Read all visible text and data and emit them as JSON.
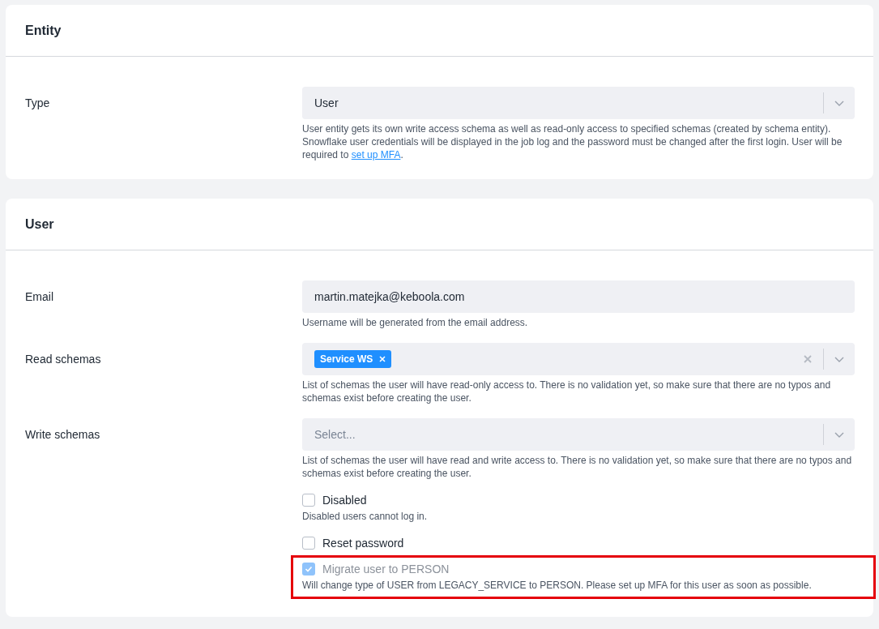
{
  "sections": [
    {
      "title": "Entity",
      "fields": [
        {
          "kind": "select",
          "label": "Type",
          "value": "User",
          "help": {
            "text": "User entity gets its own write access schema as well as read-only access to specified schemas (created by schema entity). Snowflake user credentials will be displayed in the job log and the password must be changed after the first login. User will be required to ",
            "link": "set up MFA",
            "after": "."
          }
        }
      ]
    },
    {
      "title": "User",
      "fields": [
        {
          "kind": "text",
          "label": "Email",
          "value": "martin.matejka@keboola.com",
          "help": {
            "text": "Username will be generated from the email address."
          }
        },
        {
          "kind": "multiselect",
          "label": "Read schemas",
          "tags": [
            "Service WS"
          ],
          "help": {
            "text": "List of schemas the user will have read-only access to. There is no validation yet, so make sure that there are no typos and schemas exist before creating the user."
          }
        },
        {
          "kind": "select",
          "label": "Write schemas",
          "placeholder": "Select...",
          "help": {
            "text": "List of schemas the user will have read and write access to. There is no validation yet, so make sure that there are no typos and schemas exist before creating the user."
          }
        },
        {
          "kind": "checkbox",
          "label": "Disabled",
          "checked": false,
          "disabled": false,
          "highlighted": false,
          "help": {
            "text": "Disabled users cannot log in."
          }
        },
        {
          "kind": "checkbox",
          "label": "Reset password",
          "checked": false,
          "disabled": false,
          "highlighted": false
        },
        {
          "kind": "checkbox",
          "label": "Migrate user to PERSON",
          "checked": true,
          "disabled": true,
          "highlighted": true,
          "help": {
            "text": "Will change type of USER from LEGACY_SERVICE to PERSON. Please set up MFA for this user as soon as possible."
          }
        }
      ]
    }
  ]
}
